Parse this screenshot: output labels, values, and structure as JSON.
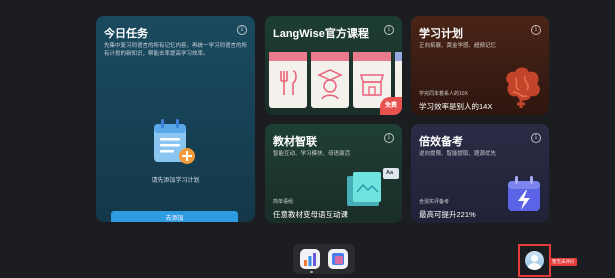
{
  "cards": {
    "today": {
      "title": "今日任务",
      "desc": "先集中复习同语言的所有记忆内容，再统一学习同语言的所有计划的新知识，帮能去率提高学习效率。",
      "hint": "请先添加学习计划",
      "add_button": "去添加",
      "icon": "calendar-add-icon"
    },
    "langwise": {
      "title": "LangWise官方课程",
      "badge": "免费",
      "icon": "course-thumbnails"
    },
    "plan": {
      "title": "学习计划",
      "desc": "正向拓展、黄金学感、超频记忆",
      "line1": "学完同本着系人的10X",
      "line2": "学习效率是别人的14X"
    },
    "textbook": {
      "title": "教材智联",
      "desc": "智能互动、学习模块、母语激活",
      "line1": "简单语组",
      "line2": "任意教材变母语互动课",
      "tag": "Aa"
    },
    "exam": {
      "title": "倍效备考",
      "desc": "逆向提限、智能提取、题源优先",
      "line1": "含混实评备考",
      "line2": "最高可提升221%"
    }
  },
  "dock": {
    "apps": [
      "chart-app-icon",
      "notes-app-icon"
    ]
  },
  "avatar": {
    "tag": "暂无未评价"
  },
  "colors": {
    "accent": "#2f9be0",
    "badge": "#e8524e",
    "highlight": "#e53b3b"
  }
}
